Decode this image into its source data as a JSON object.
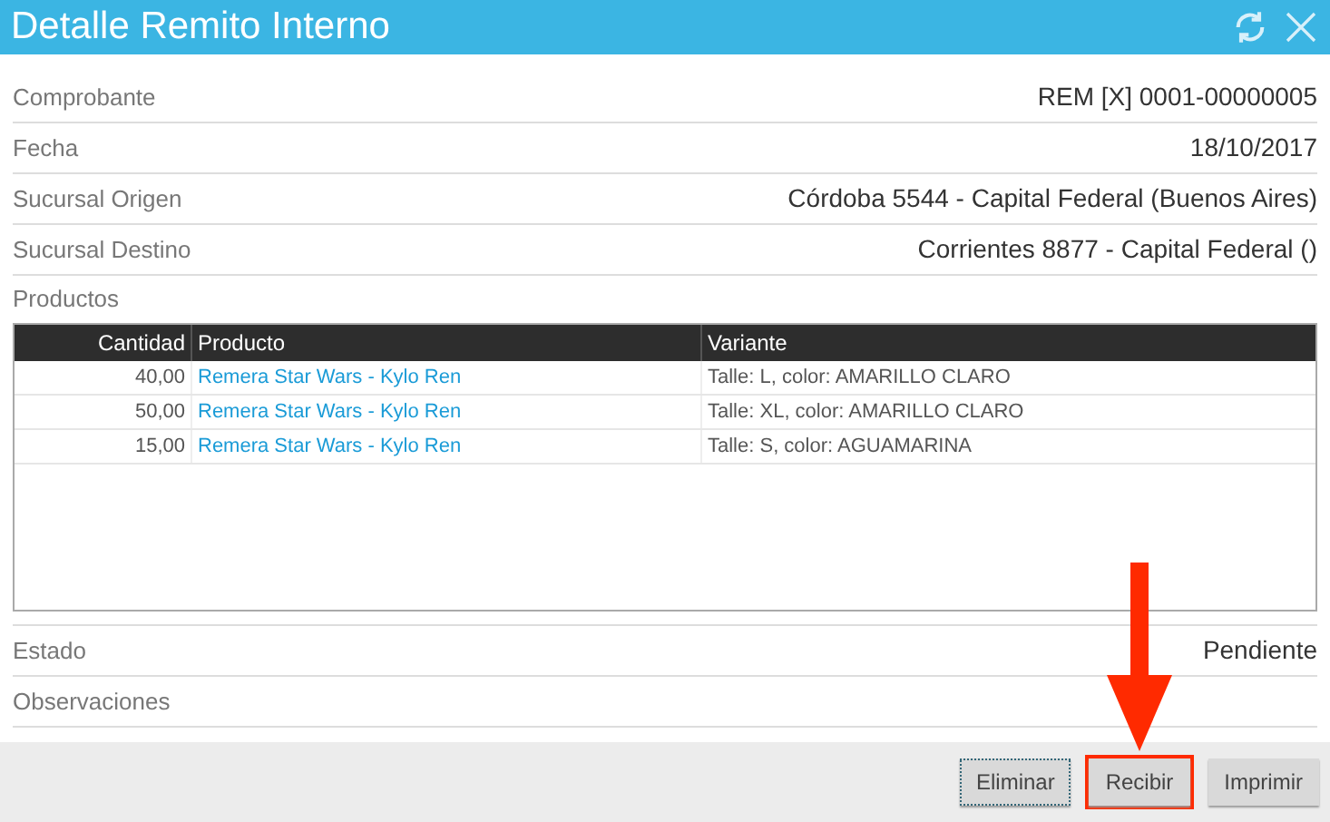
{
  "window": {
    "title": "Detalle Remito Interno"
  },
  "fields": [
    {
      "label": "Comprobante",
      "value": "REM [X] 0001-00000005"
    },
    {
      "label": "Fecha",
      "value": "18/10/2017"
    },
    {
      "label": "Sucursal Origen",
      "value": "Córdoba 5544 - Capital Federal (Buenos Aires)"
    },
    {
      "label": "Sucursal Destino",
      "value": "Corrientes 8877 - Capital Federal ()"
    }
  ],
  "products": {
    "label": "Productos",
    "table": {
      "columns": [
        "Cantidad",
        "Producto",
        "Variante"
      ],
      "rows": [
        {
          "cantidad": "40,00",
          "producto": "Remera Star Wars - Kylo Ren",
          "variante": "Talle: L, color: AMARILLO CLARO"
        },
        {
          "cantidad": "50,00",
          "producto": "Remera Star Wars - Kylo Ren",
          "variante": "Talle: XL, color: AMARILLO CLARO"
        },
        {
          "cantidad": "15,00",
          "producto": "Remera Star Wars - Kylo Ren",
          "variante": "Talle: S, color: AGUAMARINA"
        }
      ]
    }
  },
  "footer_fields": [
    {
      "label": "Estado",
      "value": "Pendiente"
    },
    {
      "label": "Observaciones"
    }
  ],
  "buttons": [
    {
      "label": "Eliminar",
      "focused": true,
      "highlighted": false
    },
    {
      "label": "Recibir",
      "focused": false,
      "highlighted": true
    },
    {
      "label": "Imprimir",
      "focused": false,
      "highlighted": false
    }
  ]
}
